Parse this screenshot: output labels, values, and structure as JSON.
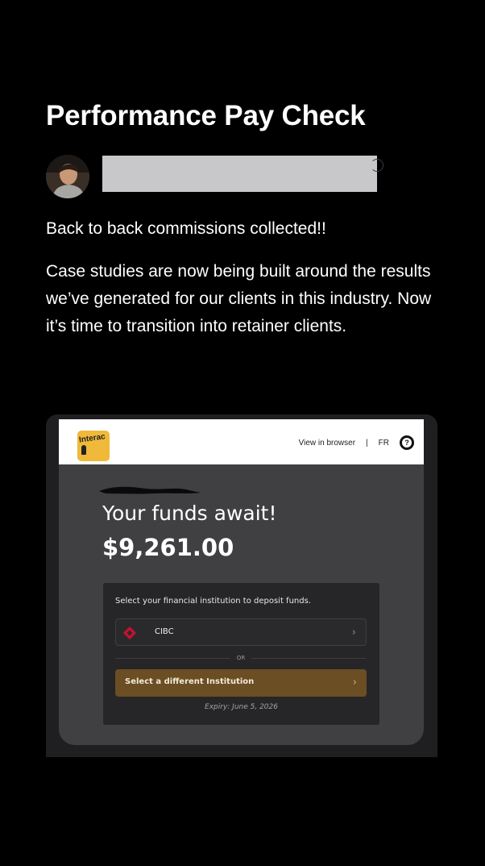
{
  "post": {
    "title": "Performance Pay Check",
    "headline": "Back to back commissions collected!!",
    "body": "Case studies are now being built around the results we’ve generated for our clients in this industry. Now it’s time to transition into retainer clients."
  },
  "email": {
    "logo_text": "Interac",
    "header_links": {
      "view_in_browser": "View in browser",
      "separator": "|",
      "language": "FR"
    },
    "headline": "Your funds await!",
    "amount": "$9,261.00",
    "deposit": {
      "instruction": "Select your financial institution to deposit funds.",
      "institution": "CIBC",
      "or_label": "OR",
      "different_button": "Select a different Institution",
      "expiry": "Expiry: June 5, 2026"
    }
  },
  "colors": {
    "background": "#000000",
    "card": "#404043",
    "deposit_box": "#262628",
    "interac_yellow": "#f0b93a",
    "cibc_red": "#c8102e",
    "button_brown": "#6b4e24"
  }
}
